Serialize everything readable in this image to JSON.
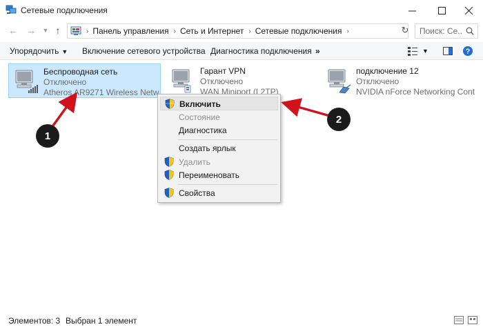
{
  "window": {
    "title": "Сетевые подключения",
    "app_icon": "network-connections-icon"
  },
  "address": {
    "crumbs": [
      "Панель управления",
      "Сеть и Интернет",
      "Сетевые подключения"
    ],
    "search_placeholder": "Поиск: Се..."
  },
  "commands": {
    "organize": "Упорядочить",
    "enable_device": "Включение сетевого устройства",
    "diagnose": "Диагностика подключения",
    "more": "»"
  },
  "connections": [
    {
      "name": "Беспроводная сеть",
      "status": "Отключено",
      "device": "Atheros AR9271 Wireless Network...",
      "selected": true,
      "icon": "wireless-adapter-icon"
    },
    {
      "name": "Гарант VPN",
      "status": "Отключено",
      "device": "WAN Miniport (L2TP)",
      "selected": false,
      "icon": "vpn-adapter-icon"
    },
    {
      "name": "подключение 12",
      "status": "Отключено",
      "device": "NVIDIA nForce Networking Contr...",
      "selected": false,
      "icon": "ethernet-adapter-icon"
    }
  ],
  "context_menu": {
    "items": [
      {
        "label": "Включить",
        "shield": true,
        "default": true,
        "disabled": false
      },
      {
        "label": "Состояние",
        "shield": false,
        "default": false,
        "disabled": true
      },
      {
        "label": "Диагностика",
        "shield": false,
        "default": false,
        "disabled": false
      },
      {
        "label": "Создать ярлык",
        "shield": false,
        "default": false,
        "disabled": false
      },
      {
        "label": "Удалить",
        "shield": true,
        "default": false,
        "disabled": true
      },
      {
        "label": "Переименовать",
        "shield": true,
        "default": false,
        "disabled": false
      },
      {
        "label": "Свойства",
        "shield": true,
        "default": false,
        "disabled": false
      }
    ]
  },
  "callouts": [
    "1",
    "2"
  ],
  "status_bar": {
    "count": "Элементов: 3",
    "selection": "Выбран 1 элемент"
  },
  "colors": {
    "selection": "#cce8ff",
    "arrow": "#d0121b",
    "callout": "#1b1b1b"
  }
}
